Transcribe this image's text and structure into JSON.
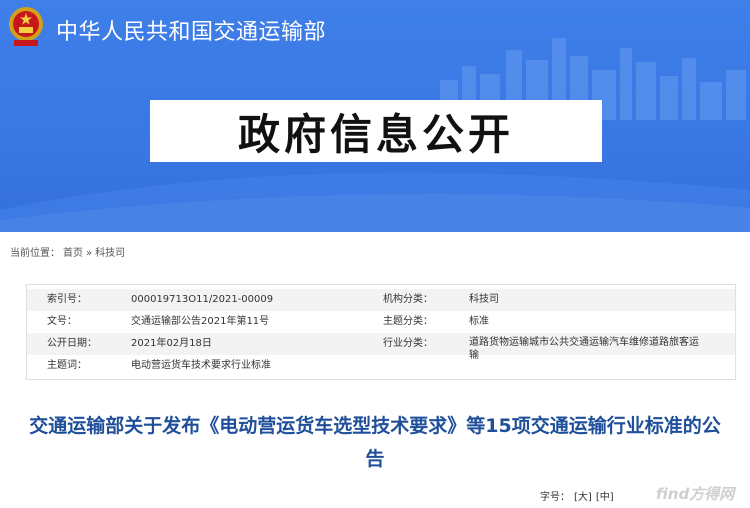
{
  "header": {
    "ministry_name": "中华人民共和国交通运输部",
    "banner_title": "政府信息公开",
    "emblem_icon": "national-emblem-icon",
    "colors": {
      "banner_blue": "#3a78e4",
      "title_blue": "#1f4f9a"
    }
  },
  "breadcrumb": {
    "label": "当前位置：",
    "items": [
      "首页",
      "»",
      "科技司"
    ]
  },
  "meta": {
    "rows": [
      {
        "label1": "索引号：",
        "value1": "000019713O11/2021-00009",
        "label2": "机构分类：",
        "value2": "科技司"
      },
      {
        "label1": "文号：",
        "value1": "交通运输部公告2021年第11号",
        "label2": "主题分类：",
        "value2": "标准"
      },
      {
        "label1": "公开日期：",
        "value1": "2021年02月18日",
        "label2": "行业分类：",
        "value2": "道路货物运输城市公共交通运输汽车维修道路旅客运输"
      },
      {
        "label1": "主题词：",
        "value1": "电动营运货车技术要求行业标准",
        "label2": "",
        "value2": ""
      }
    ]
  },
  "article": {
    "title": "交通运输部关于发布《电动营运货车选型技术要求》等15项交通运输行业标准的公告"
  },
  "font_size": {
    "label": "字号：",
    "large": "[大]",
    "medium": "[中]"
  },
  "watermark": "find方得网"
}
